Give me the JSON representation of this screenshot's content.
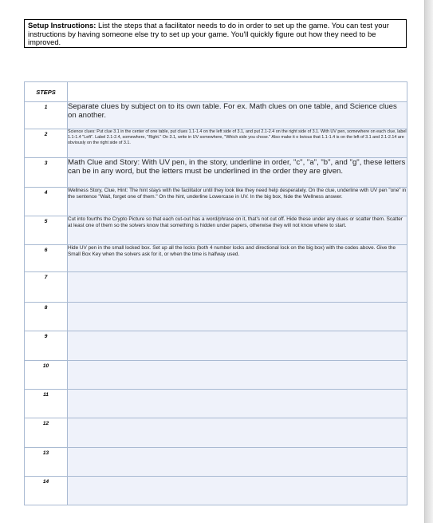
{
  "instructions": {
    "heading": "Setup Instructions:",
    "body": " List the steps that a facilitator needs to do in order to set up the game. You can test your instructions by having someone else try to set up your game. You'll quickly figure out how they need to be improved."
  },
  "table": {
    "header": "STEPS",
    "rows": [
      {
        "num": "1",
        "text": "Separate clues by subject on to its own table.  For ex. Math clues on one table, and Science clues on another."
      },
      {
        "num": "2",
        "text": "Science clues:  Put clue 3.1 in the center of one table, put clues 1.1-1.4 on the left side of 3.1, and put 2.1-2.4 on the right side of 3.1. With UV pen, somewhere on each clue, label 1.1-1.4 \"Left\".  Label 2.1-2.4, somewhere, \"Right.\"  On 3.1, write in UV somewhere, \"Which side you chose.\"   Also make it o bvious that 1.1-1.4 is on the left of 3.1 and 2.1-2.14 are obviously on the right side of 3.1."
      },
      {
        "num": "3",
        "text": "Math Clue and Story: With UV pen, in the story, underline in order, \"c\", \"a\", \"b\", and \"g\", these letters can be in any word, but the letters must be underlined in the order they are given."
      },
      {
        "num": "4",
        "text": "Wellness Story, Clue, Hint: The hint stays with the facilitator until they look like they need help desperately.  On the clue, underline with UV pen \"one\" in the sentence \"Wait, forget one of them.\"  On the hint, underline Lowercase in UV.  In the big box, hide the Wellness answer."
      },
      {
        "num": "5",
        "text": "Cut into fourths the Crypto Picture so that each cut-out has a word/phrase on it, that's not cut off.  Hide these under any clues or scatter them. Scatter at least one of them so the solvers know that something is hidden under papers, otherwise they will not know where to start."
      },
      {
        "num": "6",
        "text": "Hide UV pen in the small locked box.  Set up all the locks (both 4 number locks and directional lock on the big box) with the codes above.  Give the Small Box Key when the solvers ask for it, or when the time is halfway used."
      },
      {
        "num": "7",
        "text": ""
      },
      {
        "num": "8",
        "text": ""
      },
      {
        "num": "9",
        "text": ""
      },
      {
        "num": "10",
        "text": ""
      },
      {
        "num": "11",
        "text": ""
      },
      {
        "num": "12",
        "text": ""
      },
      {
        "num": "13",
        "text": ""
      },
      {
        "num": "14",
        "text": ""
      }
    ]
  }
}
